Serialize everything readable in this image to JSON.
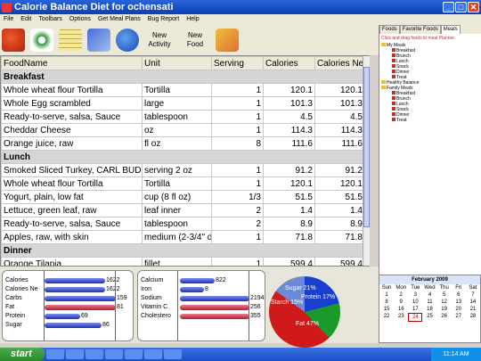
{
  "window": {
    "title": "Calorie Balance Diet for ochensati"
  },
  "menu": [
    "File",
    "Edit",
    "Toolbars",
    "Options",
    "Get Meal Plans",
    "Bug Report",
    "Help"
  ],
  "toolbar": {
    "new_activity": "New Activity",
    "new_food": "New Food"
  },
  "grid": {
    "columns": [
      "FoodName",
      "Unit",
      "Serving",
      "Calories",
      "Calories Ne"
    ],
    "rows": [
      {
        "section": "Breakfast"
      },
      {
        "name": "Whole wheat flour Tortilla",
        "unit": "Tortilla",
        "serving": "1",
        "cal": "120.1",
        "calne": "120.1"
      },
      {
        "name": "Whole Egg scrambled",
        "unit": "large",
        "serving": "1",
        "cal": "101.3",
        "calne": "101.3"
      },
      {
        "name": "Ready-to-serve, salsa, Sauce",
        "unit": "tablespoon",
        "serving": "1",
        "cal": "4.5",
        "calne": "4.5"
      },
      {
        "name": "Cheddar Cheese",
        "unit": "oz",
        "serving": "1",
        "cal": "114.3",
        "calne": "114.3"
      },
      {
        "name": "Orange juice, raw",
        "unit": "fl oz",
        "serving": "8",
        "cal": "111.6",
        "calne": "111.6"
      },
      {
        "section": "Lunch"
      },
      {
        "name": "Smoked Sliced Turkey, CARL BUDD",
        "unit": "serving 2 oz",
        "serving": "1",
        "cal": "91.2",
        "calne": "91.2"
      },
      {
        "name": "Whole wheat flour Tortilla",
        "unit": "Tortilla",
        "serving": "1",
        "cal": "120.1",
        "calne": "120.1"
      },
      {
        "name": "Yogurt, plain, low fat",
        "unit": "cup (8 fl oz)",
        "serving": "1/3",
        "cal": "51.5",
        "calne": "51.5"
      },
      {
        "name": "Lettuce, green leaf, raw",
        "unit": "leaf inner",
        "serving": "2",
        "cal": "1.4",
        "calne": "1.4"
      },
      {
        "name": "Ready-to-serve, salsa, Sauce",
        "unit": "tablespoon",
        "serving": "2",
        "cal": "8.9",
        "calne": "8.9"
      },
      {
        "name": "Apples, raw, with skin",
        "unit": "medium (2-3/4\" d",
        "serving": "1",
        "cal": "71.8",
        "calne": "71.8"
      },
      {
        "section": "Dinner"
      },
      {
        "name": "Orange Tilapia",
        "unit": "fillet",
        "serving": "1",
        "cal": "599.4",
        "calne": "599.4"
      }
    ]
  },
  "nutrients_left": [
    {
      "label": "Calories",
      "value": "1622",
      "fill": 0.85,
      "color": "blue"
    },
    {
      "label": "Calories Ne",
      "value": "1622",
      "fill": 0.85,
      "color": "blue"
    },
    {
      "label": "Carbs",
      "value": "159",
      "fill": 1.0,
      "color": "blue"
    },
    {
      "label": "Fat",
      "value": "81",
      "fill": 1.0,
      "color": "red"
    },
    {
      "label": "Protein",
      "value": "69",
      "fill": 0.5,
      "color": "blue"
    },
    {
      "label": "Sugar",
      "value": "86",
      "fill": 0.8,
      "color": "blue"
    }
  ],
  "nutrients_right": [
    {
      "label": "Calcium",
      "value": "822",
      "fill": 0.5,
      "color": "blue"
    },
    {
      "label": "Iron",
      "value": "8",
      "fill": 0.35,
      "color": "blue"
    },
    {
      "label": "Sodium",
      "value": "2194",
      "fill": 1.0,
      "color": "blue"
    },
    {
      "label": "Vitamin C",
      "value": "256",
      "fill": 1.0,
      "color": "red"
    },
    {
      "label": "Cholestero",
      "value": "355",
      "fill": 1.0,
      "color": "red"
    }
  ],
  "pie": {
    "slices": [
      {
        "label": "Sugar 21%",
        "pct": 21,
        "color": "#1a3fd0"
      },
      {
        "label": "Protein 17%",
        "pct": 17,
        "color": "#1a9a2a"
      },
      {
        "label": "Fat 47%",
        "pct": 47,
        "color": "#d01a1a"
      },
      {
        "label": "Starch 15%",
        "pct": 15,
        "color": "#6a8ad8"
      }
    ]
  },
  "right_panel": {
    "tabs": [
      "Foods",
      "Favorite Foods",
      "Meals"
    ],
    "hint": "Click and drag foods to meal Planner.",
    "tree": [
      {
        "folder": "My Meals",
        "items": [
          "Breakfast",
          "Brunch",
          "Lunch",
          "Snack",
          "Dinner",
          "Treat"
        ]
      },
      {
        "folder": "Healthy Balance",
        "items": []
      },
      {
        "folder": "Family Meals",
        "items": [
          "Breakfast",
          "Brunch",
          "Lunch",
          "Snack",
          "Dinner",
          "Treat"
        ]
      }
    ]
  },
  "calendar": {
    "month": "February 2009",
    "days": [
      "Sun",
      "Mon",
      "Tue",
      "Wed",
      "Thu",
      "Fri",
      "Sat"
    ],
    "weeks": [
      [
        "1",
        "2",
        "3",
        "4",
        "5",
        "6",
        "7"
      ],
      [
        "8",
        "9",
        "10",
        "11",
        "12",
        "13",
        "14"
      ],
      [
        "15",
        "16",
        "17",
        "18",
        "19",
        "20",
        "21"
      ],
      [
        "22",
        "23",
        "24",
        "25",
        "26",
        "27",
        "28"
      ]
    ],
    "selected": "24"
  },
  "taskbar": {
    "start": "start",
    "clock": "11:14 AM"
  }
}
